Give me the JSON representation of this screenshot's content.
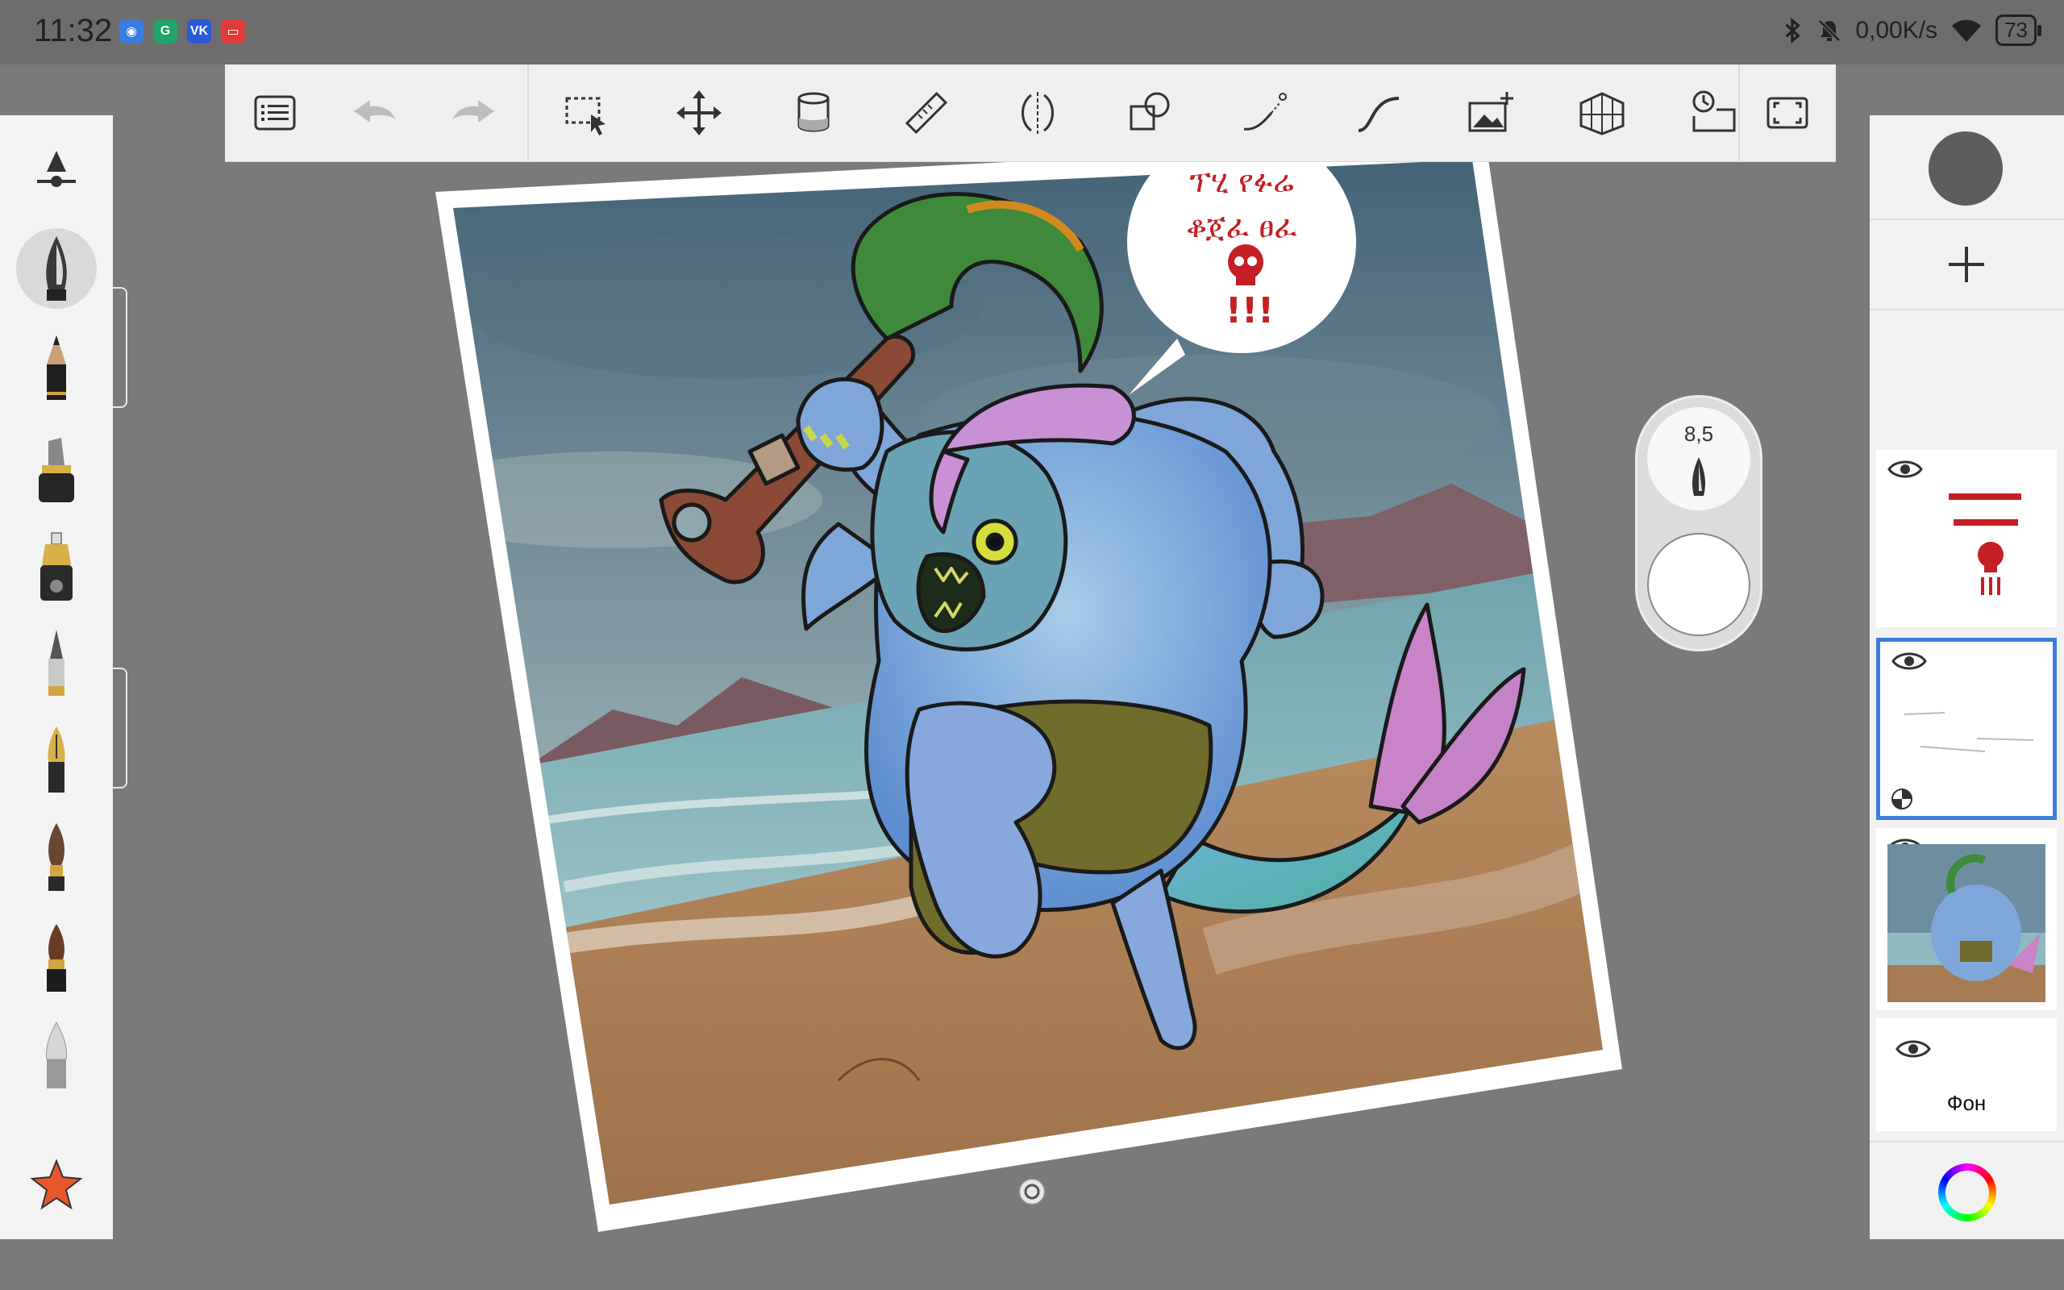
{
  "status_bar": {
    "time": "11:32",
    "network_speed": "0,00K/s",
    "battery": "73",
    "app_icons": [
      {
        "name": "browser-app-icon",
        "glyph": "◉",
        "color": "#3a7be0"
      },
      {
        "name": "green-app-icon",
        "glyph": "G",
        "color": "#1fa36a"
      },
      {
        "name": "vk-app-icon",
        "glyph": "VK",
        "color": "#2a5bd6"
      },
      {
        "name": "red-app-icon",
        "glyph": "▭",
        "color": "#e03a3a"
      }
    ]
  },
  "toolbar": {
    "items": [
      "menu",
      "undo",
      "redo",
      "selection",
      "transform",
      "fill",
      "ruler",
      "symmetry",
      "shapes",
      "stroke",
      "curve",
      "insert-image",
      "perspective",
      "time-lapse",
      "fullscreen"
    ]
  },
  "brushes": {
    "size_value": "8,5",
    "items": [
      "brush-settings",
      "inking-pen",
      "pencil",
      "marker",
      "airbrush",
      "paint-brush",
      "fountain-pen",
      "round-brush",
      "ink-brush",
      "soft-eraser",
      "favorites"
    ]
  },
  "illustration": {
    "speech_bubble_line1": "ፕሂ የፉሬ",
    "speech_bubble_line2": "ቆጀፈ ፀፈ",
    "speech_bubble_exclaim": "!!!"
  },
  "layers": {
    "current_color": "#5d5d5d",
    "background_label": "Фон",
    "items": [
      {
        "name": "speech-layer",
        "visible": true
      },
      {
        "name": "sketch-layer",
        "visible": true,
        "active": true
      },
      {
        "name": "painting-layer",
        "visible": true
      },
      {
        "name": "background-layer",
        "visible": true
      }
    ]
  },
  "colors": {
    "accent": "#3d7ed8",
    "panel_bg": "#f1f1f1",
    "workspace_bg": "#7a7a7a"
  }
}
